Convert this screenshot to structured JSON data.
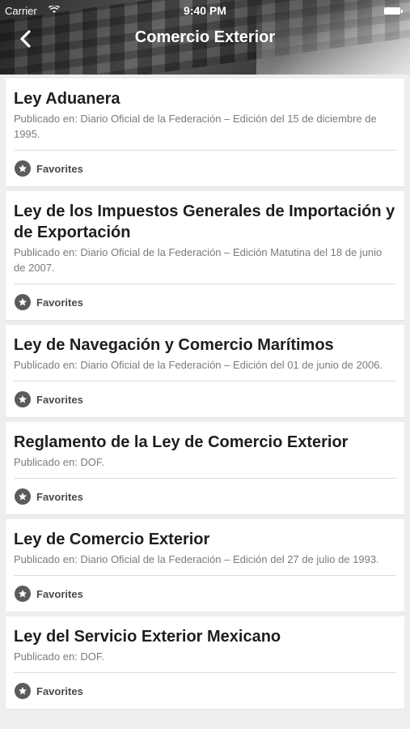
{
  "status_bar": {
    "carrier": "Carrier",
    "time": "9:40 PM"
  },
  "nav": {
    "title": "Comercio Exterior",
    "back_icon": "chevron-left-icon"
  },
  "colors": {
    "card_background": "#ffffff",
    "page_background": "#eeeeee",
    "title_text": "#1e1e1e",
    "subtitle_text": "#7b7b7b",
    "favorite_icon": "#5b5b5b"
  },
  "items": [
    {
      "title": "Ley Aduanera",
      "subtitle": "Publicado en: Diario Oficial de la Federación – Edición del 15 de diciembre de 1995.",
      "favorite_label": "Favorites"
    },
    {
      "title": "Ley de los Impuestos Generales de Importación y de Exportación",
      "subtitle": "Publicado en: Diario Oficial de la Federación – Edición Matutina del 18 de junio de 2007.",
      "favorite_label": "Favorites"
    },
    {
      "title": "Ley de Navegación y Comercio Marítimos",
      "subtitle": "Publicado en: Diario Oficial de la Federación – Edición del 01 de junio de 2006.",
      "favorite_label": "Favorites"
    },
    {
      "title": "Reglamento de la Ley de Comercio Exterior",
      "subtitle": "Publicado en: DOF.",
      "favorite_label": "Favorites"
    },
    {
      "title": "Ley de Comercio Exterior",
      "subtitle": "Publicado en: Diario Oficial de la Federación – Edición del 27 de julio de 1993.",
      "favorite_label": "Favorites"
    },
    {
      "title": "Ley del Servicio Exterior Mexicano",
      "subtitle": "Publicado en: DOF.",
      "favorite_label": "Favorites"
    }
  ]
}
